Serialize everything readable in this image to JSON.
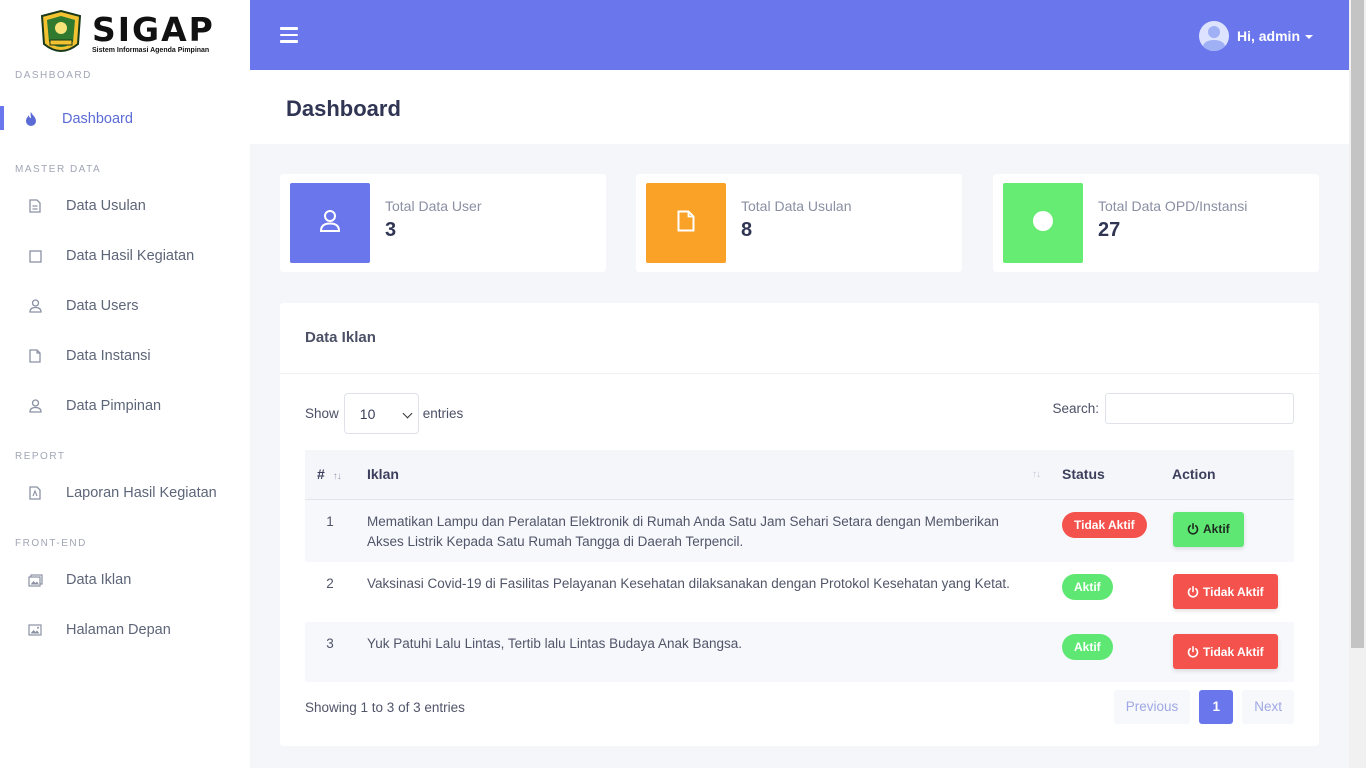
{
  "brand": {
    "title": "SIGAP",
    "subtitle": "Sistem Informasi Agenda Pimpinan"
  },
  "sidebar": {
    "sections": [
      {
        "header": "DASHBOARD",
        "items": [
          {
            "label": "Dashboard",
            "icon": "fire-icon",
            "active": true
          }
        ]
      },
      {
        "header": "MASTER DATA",
        "items": [
          {
            "label": "Data Usulan",
            "icon": "document-icon"
          },
          {
            "label": "Data Hasil Kegiatan",
            "icon": "square-icon"
          },
          {
            "label": "Data Users",
            "icon": "user-icon"
          },
          {
            "label": "Data Instansi",
            "icon": "file-icon"
          },
          {
            "label": "Data Pimpinan",
            "icon": "user-icon"
          }
        ]
      },
      {
        "header": "REPORT",
        "items": [
          {
            "label": "Laporan Hasil Kegiatan",
            "icon": "pdf-file-icon"
          }
        ]
      },
      {
        "header": "FRONT-END",
        "items": [
          {
            "label": "Data Iklan",
            "icon": "images-icon"
          },
          {
            "label": "Halaman Depan",
            "icon": "image-icon"
          }
        ]
      }
    ]
  },
  "topbar": {
    "user_greeting": "Hi, admin"
  },
  "page": {
    "title": "Dashboard"
  },
  "stats": [
    {
      "label": "Total Data User",
      "value": "3",
      "color": "#6a76ec",
      "icon": "user-icon"
    },
    {
      "label": "Total Data Usulan",
      "value": "8",
      "color": "#f9a227",
      "icon": "file-icon"
    },
    {
      "label": "Total Data OPD/Instansi",
      "value": "27",
      "color": "#67ec73",
      "icon": "circle-icon"
    }
  ],
  "table": {
    "title": "Data Iklan",
    "show_label": "Show",
    "entries_label": "entries",
    "page_size": "10",
    "search_label": "Search:",
    "search_value": "",
    "columns": {
      "num": "#",
      "iklan": "Iklan",
      "status": "Status",
      "action": "Action"
    },
    "rows": [
      {
        "num": "1",
        "iklan": "Mematikan Lampu dan Peralatan Elektronik di Rumah Anda Satu Jam Sehari Setara dengan Memberikan Akses Listrik Kepada Satu Rumah Tangga di Daerah Terpencil.",
        "status": "Tidak Aktif",
        "action": "Aktif"
      },
      {
        "num": "2",
        "iklan": "Vaksinasi Covid-19 di Fasilitas Pelayanan Kesehatan dilaksanakan dengan Protokol Kesehatan yang Ketat.",
        "status": "Aktif",
        "action": "Tidak Aktif"
      },
      {
        "num": "3",
        "iklan": "Yuk Patuhi Lalu Lintas, Tertib lalu Lintas Budaya Anak Bangsa.",
        "status": "Aktif",
        "action": "Tidak Aktif"
      }
    ],
    "info": "Showing 1 to 3 of 3 entries",
    "pagination": {
      "previous": "Previous",
      "current": "1",
      "next": "Next"
    }
  },
  "colors": {
    "primary": "#6a76ec",
    "success": "#5ee873",
    "danger": "#f3524d",
    "warning": "#f9a227"
  }
}
